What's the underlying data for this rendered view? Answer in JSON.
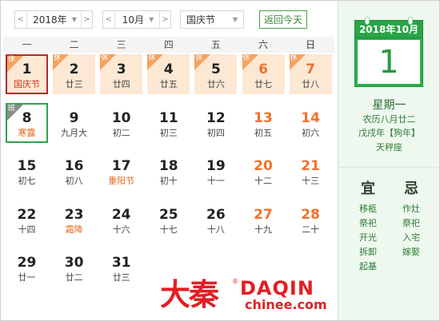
{
  "toolbar": {
    "prev": "<",
    "next": ">",
    "year": "2018年",
    "month": "10月",
    "holiday": "国庆节",
    "today_button": "返回今天"
  },
  "weekdays": [
    "一",
    "二",
    "三",
    "四",
    "五",
    "六",
    "日"
  ],
  "days": [
    {
      "day": "1",
      "sub": "国庆节",
      "tag": "休",
      "state": "selected"
    },
    {
      "day": "2",
      "sub": "廿三",
      "tag": "休",
      "state": "rest"
    },
    {
      "day": "3",
      "sub": "廿四",
      "tag": "休",
      "state": "rest"
    },
    {
      "day": "4",
      "sub": "廿五",
      "tag": "休",
      "state": "rest"
    },
    {
      "day": "5",
      "sub": "廿六",
      "tag": "休",
      "state": "rest"
    },
    {
      "day": "6",
      "sub": "廿七",
      "tag": "休",
      "state": "rest-weekend"
    },
    {
      "day": "7",
      "sub": "廿八",
      "tag": "休",
      "state": "rest-weekend"
    },
    {
      "day": "8",
      "sub": "寒露",
      "tag": "班",
      "state": "work"
    },
    {
      "day": "9",
      "sub": "九月大",
      "tag": "",
      "state": ""
    },
    {
      "day": "10",
      "sub": "初二",
      "tag": "",
      "state": ""
    },
    {
      "day": "11",
      "sub": "初三",
      "tag": "",
      "state": ""
    },
    {
      "day": "12",
      "sub": "初四",
      "tag": "",
      "state": ""
    },
    {
      "day": "13",
      "sub": "初五",
      "tag": "",
      "state": "weekend"
    },
    {
      "day": "14",
      "sub": "初六",
      "tag": "",
      "state": "weekend"
    },
    {
      "day": "15",
      "sub": "初七",
      "tag": "",
      "state": ""
    },
    {
      "day": "16",
      "sub": "初八",
      "tag": "",
      "state": ""
    },
    {
      "day": "17",
      "sub": "重阳节",
      "tag": "",
      "state": "festival"
    },
    {
      "day": "18",
      "sub": "初十",
      "tag": "",
      "state": ""
    },
    {
      "day": "19",
      "sub": "十一",
      "tag": "",
      "state": ""
    },
    {
      "day": "20",
      "sub": "十二",
      "tag": "",
      "state": "weekend"
    },
    {
      "day": "21",
      "sub": "十三",
      "tag": "",
      "state": "weekend"
    },
    {
      "day": "22",
      "sub": "十四",
      "tag": "",
      "state": ""
    },
    {
      "day": "23",
      "sub": "霜降",
      "tag": "",
      "state": "festival"
    },
    {
      "day": "24",
      "sub": "十六",
      "tag": "",
      "state": ""
    },
    {
      "day": "25",
      "sub": "十七",
      "tag": "",
      "state": ""
    },
    {
      "day": "26",
      "sub": "十八",
      "tag": "",
      "state": ""
    },
    {
      "day": "27",
      "sub": "十九",
      "tag": "",
      "state": "weekend"
    },
    {
      "day": "28",
      "sub": "二十",
      "tag": "",
      "state": "weekend"
    },
    {
      "day": "29",
      "sub": "廿一",
      "tag": "",
      "state": ""
    },
    {
      "day": "30",
      "sub": "廿二",
      "tag": "",
      "state": ""
    },
    {
      "day": "31",
      "sub": "廿三",
      "tag": "",
      "state": ""
    }
  ],
  "panel": {
    "card_header": "2018年10月",
    "card_day": "1",
    "weekday": "星期一",
    "lunar": "农历八月廿二",
    "ganzhi": "戊戌年【狗年】",
    "zodiac": "天秤座",
    "yi_title": "宜",
    "ji_title": "忌",
    "yi": [
      "移柩",
      "祭祀",
      "开光",
      "拆卸",
      "起基"
    ],
    "ji": [
      "作灶",
      "祭祀",
      "入宅",
      "嫁娶"
    ]
  },
  "logo": {
    "cn": "大秦",
    "reg": "®",
    "en": "DAQIN",
    "domain": "chinee.com"
  },
  "colors": {
    "accent_green": "#2bae4c",
    "weekend_orange": "#f0712b",
    "rest_bg": "#fde8d4",
    "logo_red": "#e31e24"
  }
}
